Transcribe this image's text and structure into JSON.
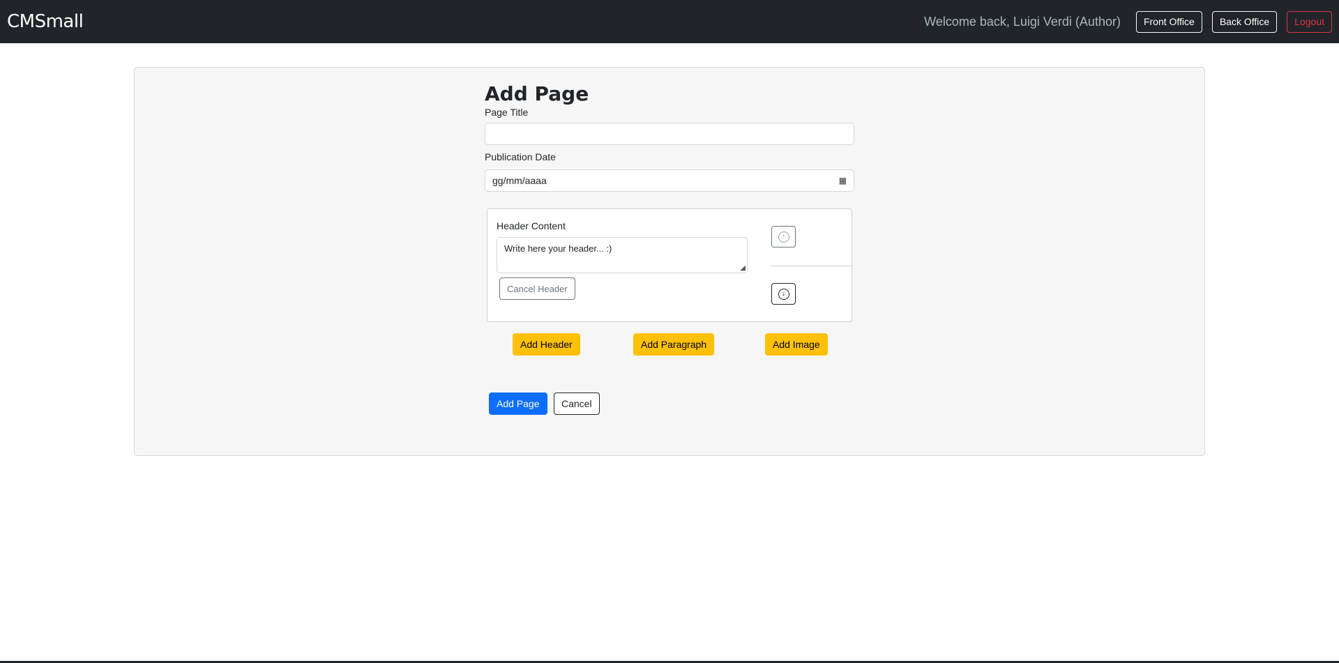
{
  "navbar": {
    "brand": "CMSmall",
    "welcome": "Welcome back, Luigi Verdi (Author)",
    "front_office": "Front Office",
    "back_office": "Back Office",
    "logout": "Logout"
  },
  "form": {
    "title": "Add Page",
    "page_title_label": "Page Title",
    "page_title_value": "",
    "publication_date_label": "Publication Date",
    "publication_date_value": "gg/mm/aaaa",
    "calendar_icon": "calendar-icon"
  },
  "block": {
    "label": "Header Content",
    "text": "Write here your header... :)",
    "cancel": "Cancel Header",
    "up_icon": "arrow-up-circle-icon",
    "down_icon": "arrow-down-circle-icon"
  },
  "actions": {
    "add_header": "Add Header",
    "add_paragraph": "Add Paragraph",
    "add_image": "Add Image",
    "add_page": "Add Page",
    "cancel": "Cancel"
  },
  "colors": {
    "navbar": "#212529",
    "primary": "#0d6efd",
    "warning": "#ffc107",
    "danger": "#dc3545"
  }
}
